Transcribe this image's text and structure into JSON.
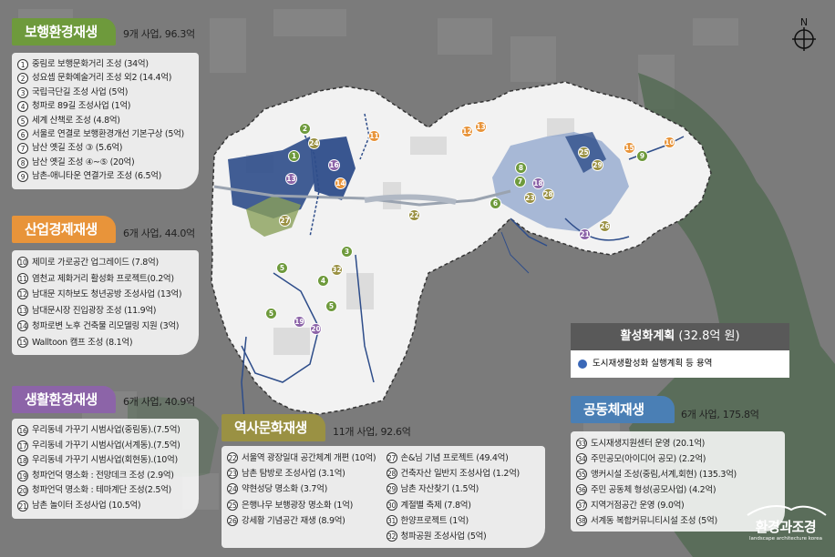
{
  "compass_label": "N",
  "logo": {
    "main": "환경과조경",
    "sub": "landscape architecture korea"
  },
  "activation": {
    "title": "활성화계획",
    "amount": "(32.8억 원)",
    "legend": "도시재생활성화 실행계획 등 용역",
    "dot_color": "#3a68b8"
  },
  "categories": {
    "walking": {
      "title": "보행환경재생",
      "summary": "9개 사업, 96.3억",
      "color": "#6e9a3c",
      "items": [
        {
          "n": "1",
          "t": "중림로 보행문화거리 조성 (34억)"
        },
        {
          "n": "2",
          "t": "성요셉 문화예술거리 조성 외2 (14.4억)"
        },
        {
          "n": "3",
          "t": "국립극단길 조성 사업 (5억)"
        },
        {
          "n": "4",
          "t": "청파로 89길 조성사업 (1억)"
        },
        {
          "n": "5",
          "t": "세계 산책로 조성 (4.8억)"
        },
        {
          "n": "6",
          "t": "서울로 연결로 보행환경개선 기본구상 (5억)"
        },
        {
          "n": "7",
          "t": "남산 옛길 조성 ③ (5.6억)"
        },
        {
          "n": "8",
          "t": "남산 옛길 조성 ④~⑤ (20억)"
        },
        {
          "n": "9",
          "t": "남촌-애니타운 연결가로 조성 (6.5억)"
        }
      ]
    },
    "industry": {
      "title": "산업경제재생",
      "summary": "6개 사업, 44.0억",
      "color": "#e8943a",
      "items": [
        {
          "n": "10",
          "t": "제미로 가로공간 업그레이드 (7.8억)"
        },
        {
          "n": "11",
          "t": "염천교 제화거리 활성화 프로젝트(0.2억)"
        },
        {
          "n": "12",
          "t": "남대문 지하보도 청년공방 조성사업 (13억)"
        },
        {
          "n": "13",
          "t": "남대문시장 진입광장 조성 (11.9억)"
        },
        {
          "n": "14",
          "t": "청파로변 노후 건축물 리모델링 지원 (3억)"
        },
        {
          "n": "15",
          "t": "Walltoon 캠프 조성 (8.1억)"
        }
      ]
    },
    "living": {
      "title": "생활환경재생",
      "summary": "6개 사업, 40.9억",
      "color": "#8c64a8",
      "items": [
        {
          "n": "16",
          "t": "우리동네 가꾸기 시범사업(중림동).(7.5억)"
        },
        {
          "n": "17",
          "t": "우리동네 가꾸기 시범사업(서계동).(7.5억)"
        },
        {
          "n": "18",
          "t": "우리동네 가꾸기 시범사업(회현동).(10억)"
        },
        {
          "n": "19",
          "t": "청파언덕 명소화 : 전망데크 조성 (2.9억)"
        },
        {
          "n": "20",
          "t": "청파언덕 명소화 : 테마계단 조성(2.5억)"
        },
        {
          "n": "21",
          "t": "남촌 놀이터 조성사업 (10.5억)"
        }
      ]
    },
    "history": {
      "title": "역사문화재생",
      "summary": "11개 사업, 92.6억",
      "color": "#9a9143",
      "items_left": [
        {
          "n": "22",
          "t": "서울역 광장일대 공간체계 개편 (10억)"
        },
        {
          "n": "23",
          "t": "남촌 탐방로 조성사업 (3.1억)"
        },
        {
          "n": "24",
          "t": "약현성당 명소화 (3.7억)"
        },
        {
          "n": "25",
          "t": "은행나무 보행광장 명소화 (1억)"
        },
        {
          "n": "26",
          "t": "강세황 기념공간 재생 (8.9억)"
        }
      ],
      "items_right": [
        {
          "n": "27",
          "t": "손&님 기념 프로젝트 (49.4억)"
        },
        {
          "n": "28",
          "t": "건축자산 일반지 조성사업 (1.2억)"
        },
        {
          "n": "29",
          "t": "남촌 자산찾기 (1.5억)"
        },
        {
          "n": "30",
          "t": "계절별 축제 (7.8억)"
        },
        {
          "n": "31",
          "t": "한양프로젝트 (1억)"
        },
        {
          "n": "32",
          "t": "청파공원 조성사업 (5억)"
        }
      ]
    },
    "community": {
      "title": "공동체재생",
      "summary": "6개 사업, 175.8억",
      "color": "#4a7fb5",
      "items": [
        {
          "n": "33",
          "t": "도시재생지원센터 운영 (20.1억)"
        },
        {
          "n": "34",
          "t": "주민공모(아이디어 공모) (2.2억)"
        },
        {
          "n": "35",
          "t": "앵커시설 조성(중림,서계,회현) (135.3억)"
        },
        {
          "n": "36",
          "t": "주민 공동체 형성(공모사업) (4.2억)"
        },
        {
          "n": "37",
          "t": "지역거점공간 운영 (9.0억)"
        },
        {
          "n": "38",
          "t": "서계동 복합커뮤니티시설 조성 (5억)"
        }
      ]
    }
  },
  "map_markers": [
    {
      "n": "1",
      "type": "walking"
    },
    {
      "n": "2",
      "type": "walking"
    },
    {
      "n": "3",
      "type": "walking"
    },
    {
      "n": "4",
      "type": "walking"
    },
    {
      "n": "5",
      "type": "walking"
    },
    {
      "n": "5",
      "type": "walking"
    },
    {
      "n": "5",
      "type": "walking"
    },
    {
      "n": "6",
      "type": "walking"
    },
    {
      "n": "7",
      "type": "walking"
    },
    {
      "n": "8",
      "type": "walking"
    },
    {
      "n": "9",
      "type": "walking"
    },
    {
      "n": "10",
      "type": "industry"
    },
    {
      "n": "11",
      "type": "industry"
    },
    {
      "n": "12",
      "type": "industry"
    },
    {
      "n": "13",
      "type": "industry"
    },
    {
      "n": "14",
      "type": "industry"
    },
    {
      "n": "15",
      "type": "industry"
    },
    {
      "n": "13",
      "type": "living"
    },
    {
      "n": "16",
      "type": "living"
    },
    {
      "n": "18",
      "type": "living"
    },
    {
      "n": "19",
      "type": "living"
    },
    {
      "n": "20",
      "type": "living"
    },
    {
      "n": "21",
      "type": "living"
    },
    {
      "n": "22",
      "type": "history"
    },
    {
      "n": "23",
      "type": "history"
    },
    {
      "n": "24",
      "type": "history"
    },
    {
      "n": "25",
      "type": "history"
    },
    {
      "n": "26",
      "type": "history"
    },
    {
      "n": "27",
      "type": "history"
    },
    {
      "n": "28",
      "type": "history"
    },
    {
      "n": "29",
      "type": "history"
    },
    {
      "n": "32",
      "type": "history"
    }
  ]
}
